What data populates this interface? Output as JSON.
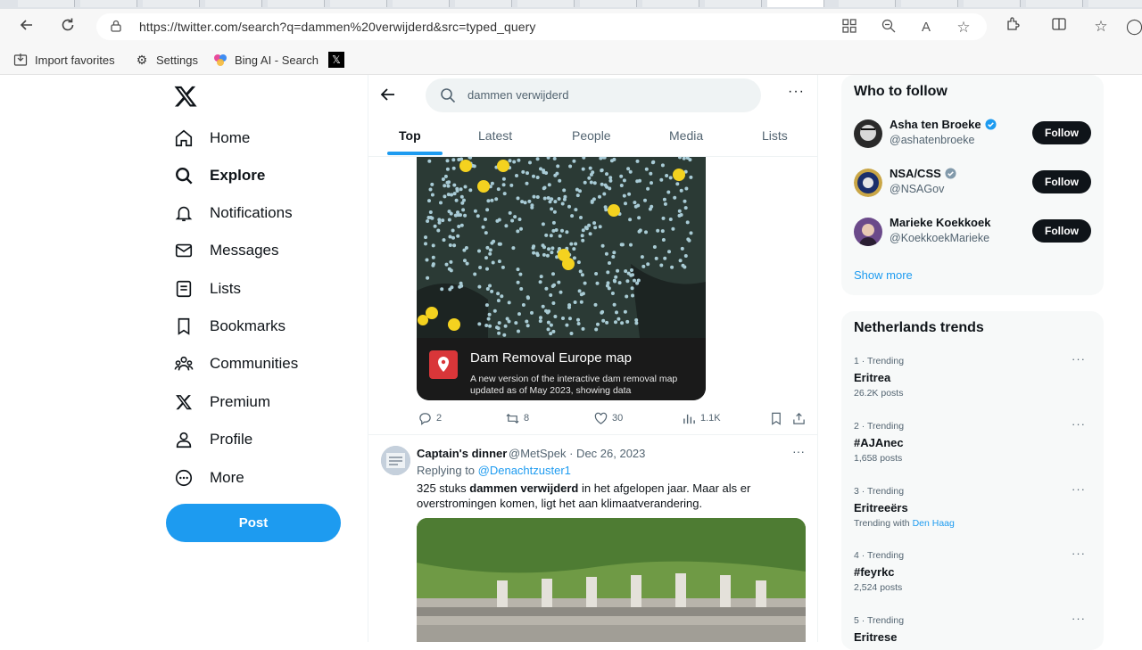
{
  "browser": {
    "url": "https://twitter.com/search?q=dammen%20verwijderd&src=typed_query",
    "favorites": [
      {
        "label": "Import favorites",
        "icon": "import-icon"
      },
      {
        "label": "Settings",
        "icon": "gear-icon"
      },
      {
        "label": "Bing AI - Search",
        "icon": "bing-icon"
      },
      {
        "label": "",
        "icon": "x-favicon-icon"
      }
    ]
  },
  "nav": {
    "items": [
      {
        "label": "Home",
        "icon": "home-icon"
      },
      {
        "label": "Explore",
        "icon": "search-icon"
      },
      {
        "label": "Notifications",
        "icon": "bell-icon"
      },
      {
        "label": "Messages",
        "icon": "envelope-icon"
      },
      {
        "label": "Lists",
        "icon": "list-icon"
      },
      {
        "label": "Bookmarks",
        "icon": "bookmark-icon"
      },
      {
        "label": "Communities",
        "icon": "people-icon"
      },
      {
        "label": "Premium",
        "icon": "x-icon"
      },
      {
        "label": "Profile",
        "icon": "person-icon"
      },
      {
        "label": "More",
        "icon": "more-circle-icon"
      }
    ],
    "post_label": "Post"
  },
  "search": {
    "query": "dammen verwijderd",
    "tabs": [
      "Top",
      "Latest",
      "People",
      "Media",
      "Lists"
    ],
    "active_tab": "Top"
  },
  "tweet1": {
    "card_title": "Dam Removal Europe map",
    "card_desc": "A new version of the interactive dam removal map updated as of May 2023, showing data",
    "replies": "2",
    "reposts": "8",
    "likes": "30",
    "views": "1.1K"
  },
  "tweet2": {
    "name": "Captain's dinner",
    "handle": "@MetSpek · Dec 26, 2023",
    "replying_prefix": "Replying to ",
    "replying_to": "@Denachtzuster1",
    "text_before": "325 stuks ",
    "text_bold": "dammen verwijderd",
    "text_after": " in het afgelopen jaar. Maar als er overstromingen komen, ligt het aan klimaatverandering."
  },
  "who_to_follow": {
    "title": "Who to follow",
    "users": [
      {
        "name": "Asha ten Broeke",
        "handle": "@ashatenbroeke",
        "verified": "blue",
        "follow": "Follow"
      },
      {
        "name": "NSA/CSS",
        "handle": "@NSAGov",
        "verified": "gray",
        "follow": "Follow"
      },
      {
        "name": "Marieke Koekkoek",
        "handle": "@KoekkoekMarieke",
        "verified": "none",
        "follow": "Follow"
      }
    ],
    "show_more": "Show more"
  },
  "trends": {
    "title": "Netherlands trends",
    "items": [
      {
        "meta": "1 · Trending",
        "name": "Eritrea",
        "posts": "26.2K posts"
      },
      {
        "meta": "2 · Trending",
        "name": "#AJAnec",
        "posts": "1,658 posts"
      },
      {
        "meta": "3 · Trending",
        "name": "Eritreeërs",
        "posts_prefix": "Trending with ",
        "posts_link": "Den Haag"
      },
      {
        "meta": "4 · Trending",
        "name": "#feyrkc",
        "posts": "2,524 posts"
      },
      {
        "meta": "5 · Trending",
        "name": "Eritrese",
        "posts": ""
      }
    ]
  },
  "colors": {
    "accent": "#1d9bf0",
    "text": "#0f1419",
    "muted": "#536471"
  }
}
